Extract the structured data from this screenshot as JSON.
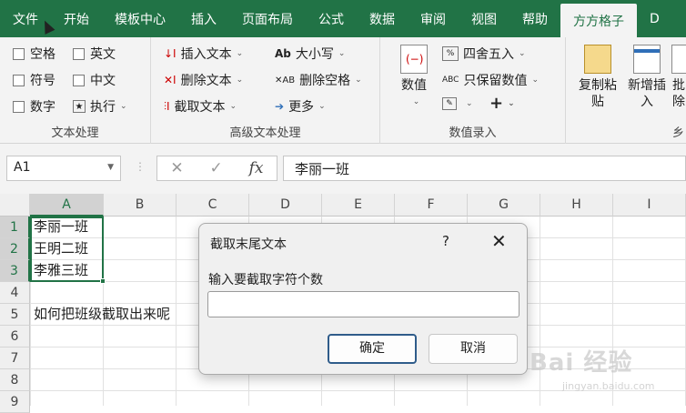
{
  "tabs": [
    "文件",
    "开始",
    "模板中心",
    "插入",
    "页面布局",
    "公式",
    "数据",
    "审阅",
    "视图",
    "帮助",
    "方方格子",
    "D"
  ],
  "active_tab": "方方格子",
  "ribbon": {
    "text_group": {
      "label": "文本处理",
      "items": [
        "空格",
        "英文",
        "符号",
        "中文",
        "数字",
        "执行"
      ]
    },
    "advanced_group": {
      "label": "高级文本处理",
      "insert_text": "插入文本",
      "delete_text": "删除文本",
      "cut_text": "截取文本",
      "case": "大小写",
      "delete_spaces": "删除空格",
      "more": "更多"
    },
    "value_group": {
      "label": "数值录入",
      "value_btn": "数值",
      "round": "四舍五入",
      "keep_value": "只保留数值",
      "plus": "+"
    },
    "extra": {
      "copy_paste": "复制粘\n贴",
      "add_insert": "新增插\n入",
      "batch": "批\n除",
      "cut_label": "乡"
    }
  },
  "formula_bar": {
    "name_box": "A1",
    "fx": "fx",
    "content": "李丽一班"
  },
  "grid": {
    "columns": [
      "A",
      "B",
      "C",
      "D",
      "E",
      "F",
      "G",
      "H",
      "I"
    ],
    "rows": [
      "1",
      "2",
      "3",
      "4",
      "5",
      "6",
      "7",
      "8",
      "9"
    ],
    "cells": {
      "A1": "李丽一班",
      "A2": "王明二班",
      "A3": "李雅三班",
      "A5": "如何把班级截取出来呢"
    }
  },
  "dialog": {
    "title": "截取末尾文本",
    "help": "?",
    "close": "✕",
    "prompt": "输入要截取字符个数",
    "input_value": "",
    "ok": "确定",
    "cancel": "取消"
  },
  "watermark": {
    "text": "Bai 经验",
    "sub": "jingyan.baidu.com"
  }
}
